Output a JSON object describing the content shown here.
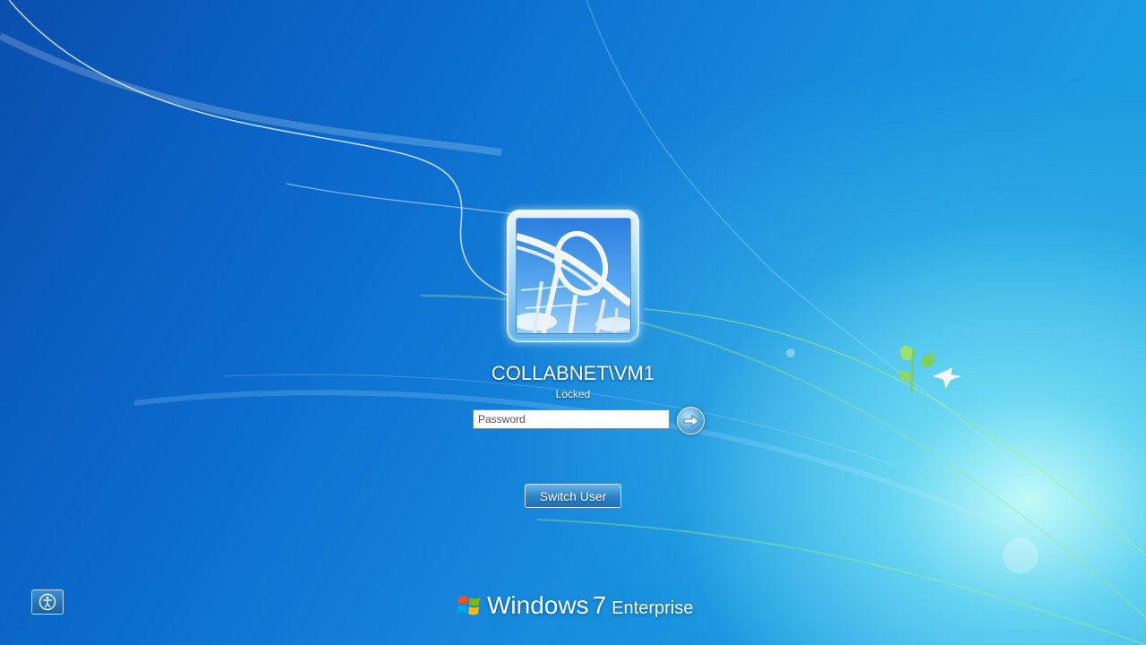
{
  "user": {
    "name": "COLLABNET\\VM1",
    "status": "Locked"
  },
  "password": {
    "placeholder": "Password",
    "value": ""
  },
  "buttons": {
    "switch_user_label": "Switch User"
  },
  "branding": {
    "name": "Windows",
    "version": "7",
    "edition": "Enterprise"
  },
  "icons": {
    "submit": "right-arrow-icon",
    "ease_of_access": "ease-of-access-icon",
    "logo": "windows-flag-logo"
  },
  "colors": {
    "background_dark": "#0a4fae",
    "background_light": "#2aa9e6",
    "text": "#ffffff"
  }
}
